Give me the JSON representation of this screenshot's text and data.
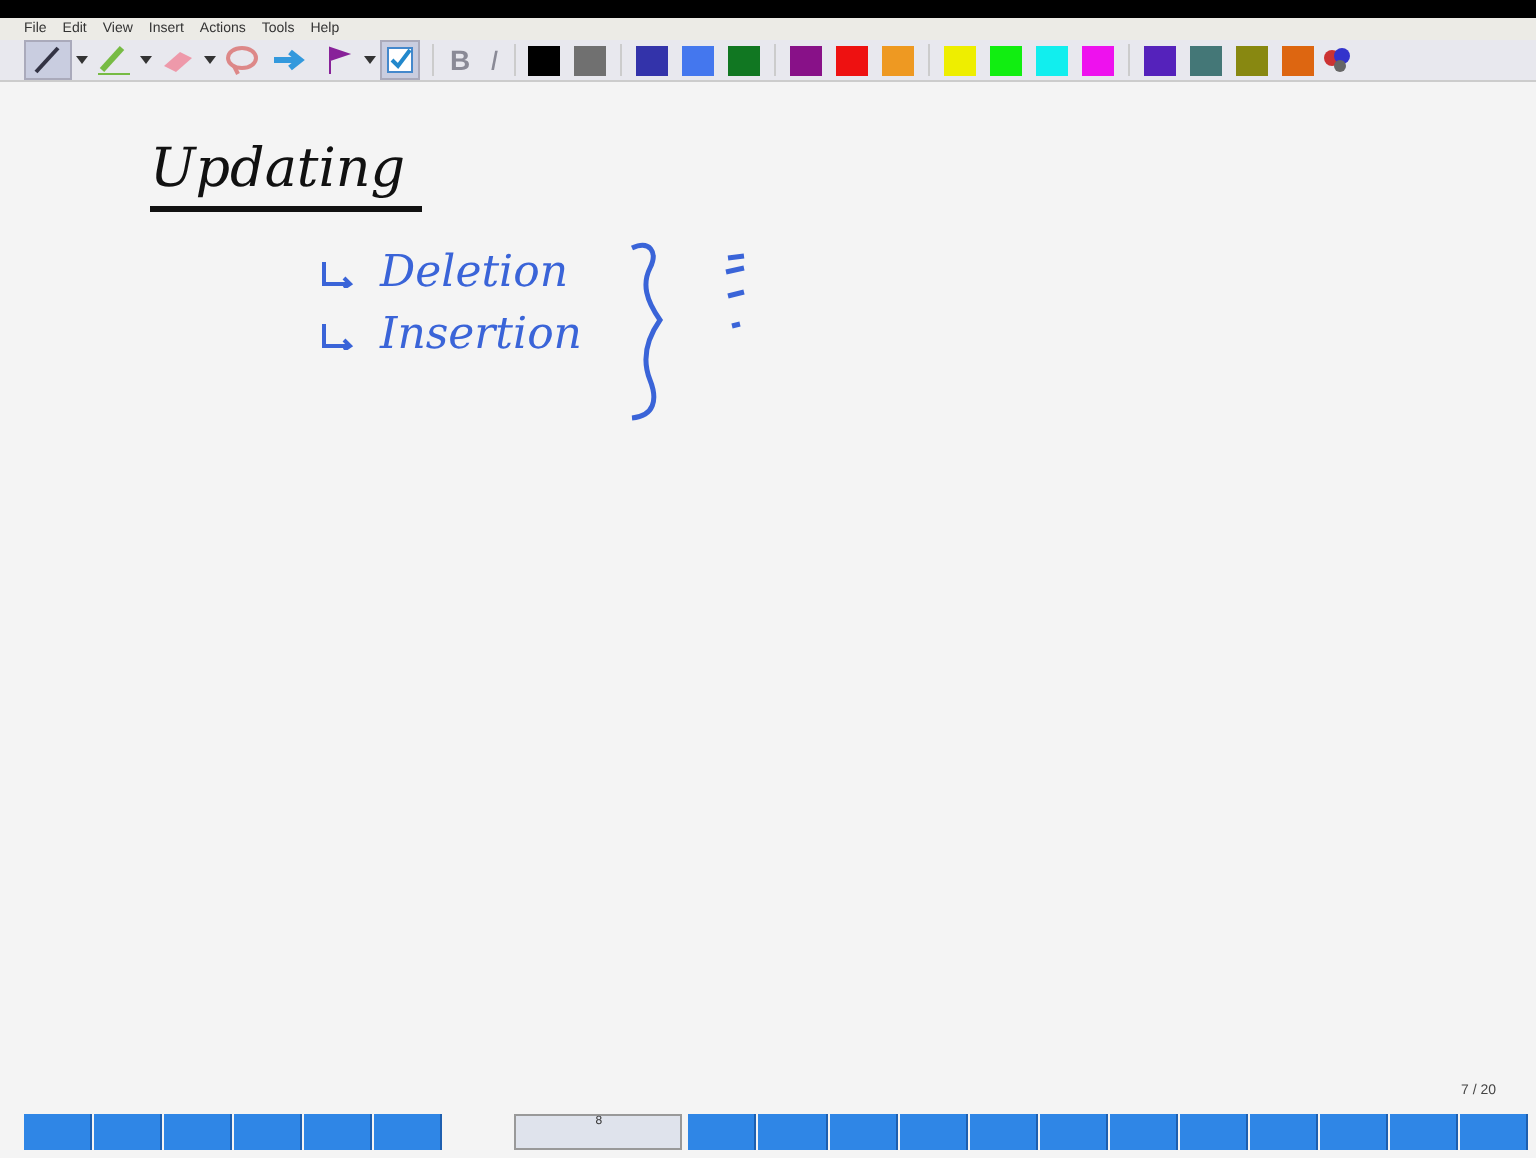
{
  "menu": [
    "File",
    "Edit",
    "View",
    "Insert",
    "Actions",
    "Tools",
    "Help"
  ],
  "format_buttons": [
    {
      "label": "B",
      "disabled": true
    },
    {
      "label": "I",
      "disabled": true
    }
  ],
  "palette": [
    {
      "color": "#000000"
    },
    {
      "color": "#707070"
    },
    {
      "color": "#3333aa"
    },
    {
      "color": "#4477ee"
    },
    {
      "color": "#117722"
    },
    {
      "color": "#881188"
    },
    {
      "color": "#ee1111"
    },
    {
      "color": "#ee9922"
    },
    {
      "color": "#eeee00"
    },
    {
      "color": "#11ee11"
    },
    {
      "color": "#11eeee"
    },
    {
      "color": "#ee11ee"
    },
    {
      "color": "#5522bb"
    },
    {
      "color": "#447777"
    },
    {
      "color": "#888811"
    },
    {
      "color": "#dd6611"
    }
  ],
  "note": {
    "heading": "Updating",
    "items": [
      {
        "text": "Deletion"
      },
      {
        "text": "Insertion"
      }
    ]
  },
  "page_counter": "7 / 20",
  "page_strip": {
    "current": "8"
  }
}
